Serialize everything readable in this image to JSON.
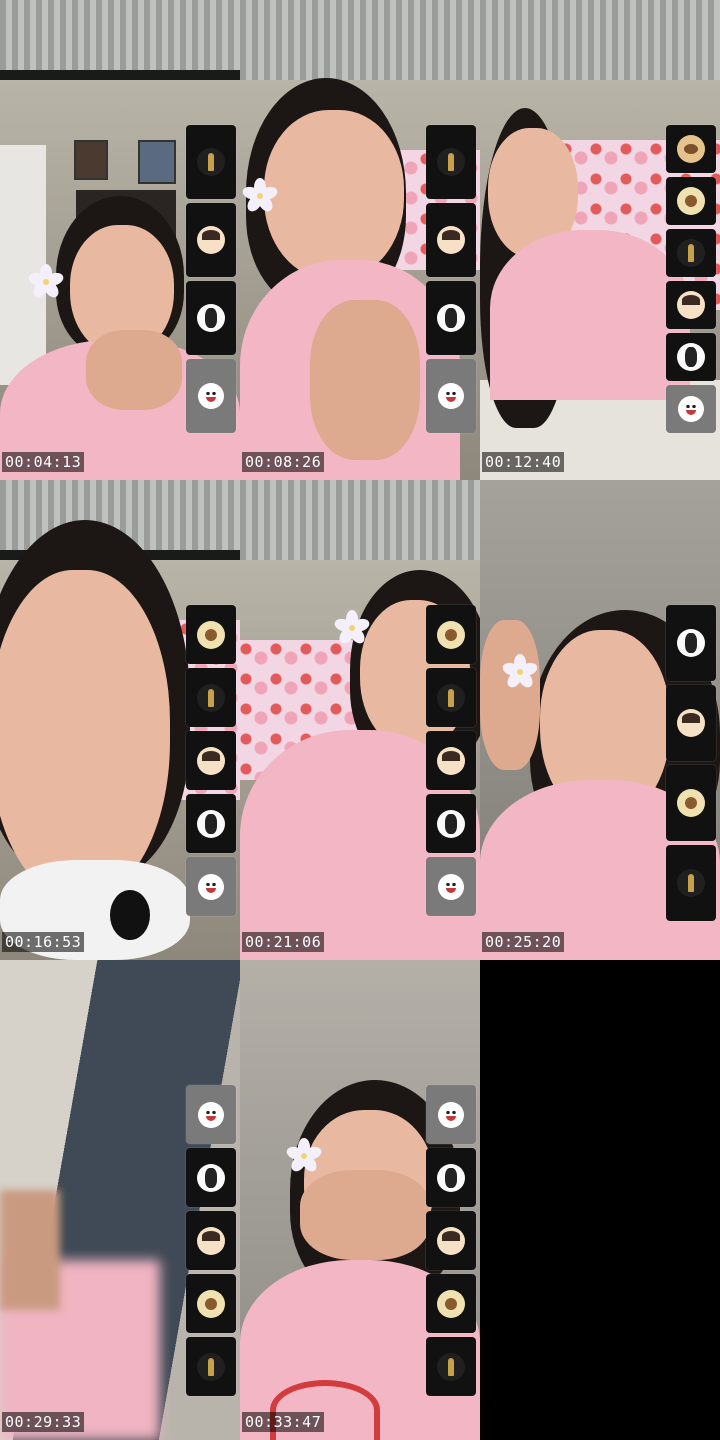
{
  "cells": [
    {
      "timestamp": "00:04:13",
      "thumbs": [
        "trophy-icon",
        "cartoon-face-icon",
        "tuxedo-icon",
        "smiley-face-icon"
      ]
    },
    {
      "timestamp": "00:08:26",
      "thumbs": [
        "trophy-icon",
        "cartoon-face-icon",
        "tuxedo-icon",
        "smiley-face-icon"
      ]
    },
    {
      "timestamp": "00:12:40",
      "thumbs": [
        "cat-icon",
        "bird-icon",
        "trophy-icon",
        "cartoon-face-icon",
        "tuxedo-icon",
        "smiley-face-icon"
      ]
    },
    {
      "timestamp": "00:16:53",
      "thumbs": [
        "bird-icon",
        "trophy-icon",
        "cartoon-face-icon",
        "tuxedo-icon",
        "smiley-face-icon"
      ]
    },
    {
      "timestamp": "00:21:06",
      "thumbs": [
        "bird-icon",
        "trophy-icon",
        "cartoon-face-icon",
        "tuxedo-icon",
        "smiley-face-icon"
      ]
    },
    {
      "timestamp": "00:25:20",
      "thumbs": [
        "tuxedo-icon",
        "cartoon-face-icon",
        "bird-icon",
        "trophy-icon"
      ]
    },
    {
      "timestamp": "00:29:33",
      "thumbs": [
        "smiley-face-icon",
        "tuxedo-icon",
        "cartoon-face-icon",
        "bird-icon",
        "trophy-icon"
      ]
    },
    {
      "timestamp": "00:33:47",
      "thumbs": [
        "smiley-face-icon",
        "tuxedo-icon",
        "cartoon-face-icon",
        "bird-icon",
        "trophy-icon"
      ]
    }
  ],
  "colors": {
    "background": "#000000",
    "timestamp_bg": "#00000088",
    "shirt": "#f3b6c4"
  }
}
